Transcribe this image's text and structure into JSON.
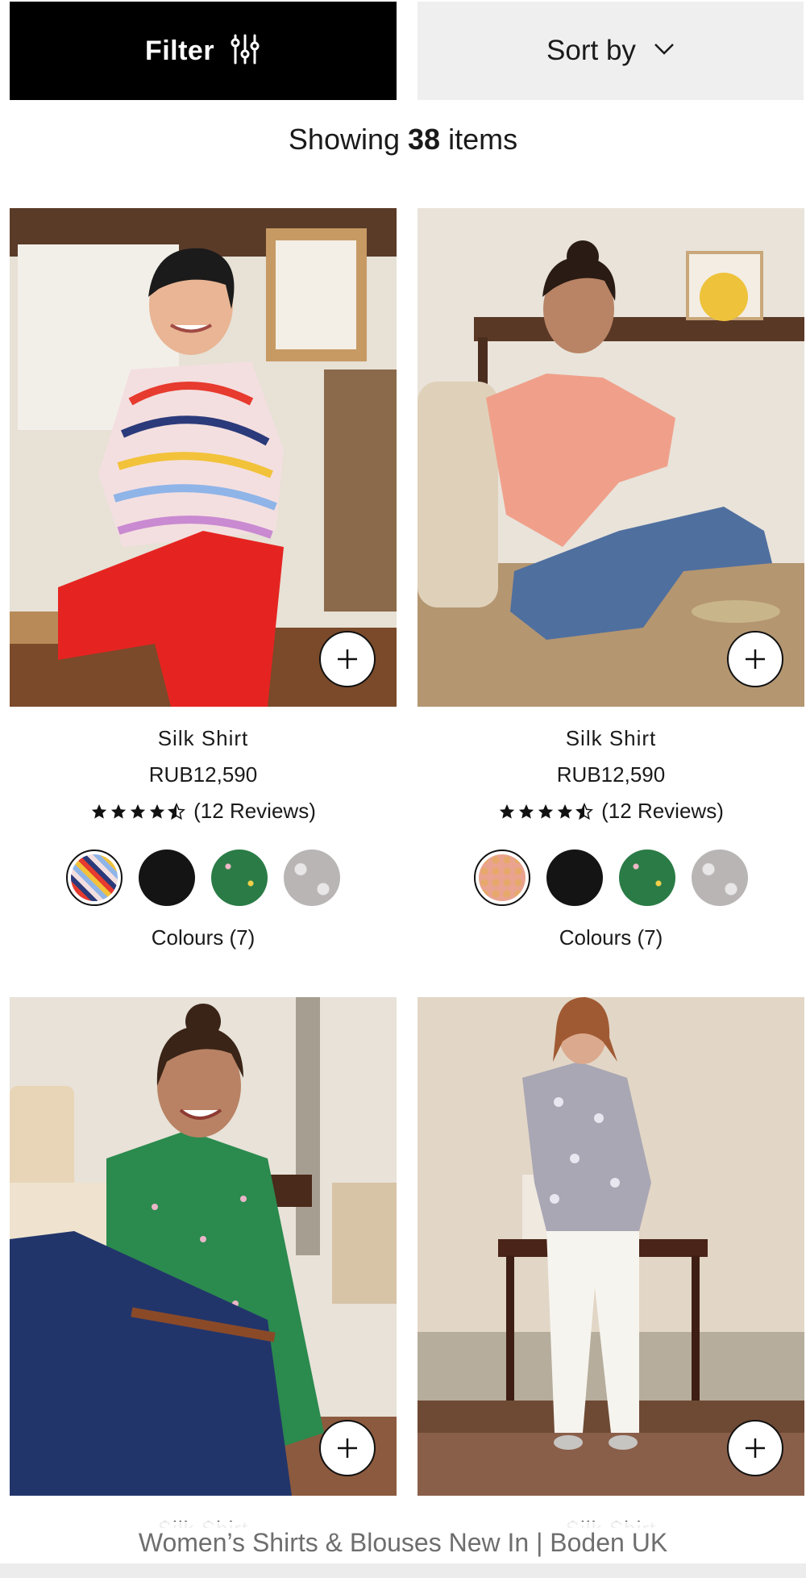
{
  "toolbar": {
    "filter_label": "Filter",
    "filter_icon": "sliders-icon",
    "sort_label": "Sort by",
    "sort_icon": "chevron-down-icon"
  },
  "results": {
    "prefix": "Showing",
    "count": "38",
    "suffix": "items"
  },
  "products": [
    {
      "name": "Silk Shirt",
      "price": "RUB12,590",
      "rating": 4.5,
      "reviews": "(12 Reviews)",
      "swatches": [
        "rainbow-stripe",
        "black",
        "green-floral",
        "grey-spot"
      ],
      "selected_swatch": 0,
      "colours": "Colours (7)"
    },
    {
      "name": "Silk Shirt",
      "price": "RUB12,590",
      "rating": 4.5,
      "reviews": "(12 Reviews)",
      "swatches": [
        "pink-geo",
        "black",
        "green-floral",
        "grey-spot"
      ],
      "selected_swatch": 0,
      "colours": "Colours (7)"
    }
  ],
  "page_title": "Women’s Shirts & Blouses New In | Boden UK",
  "colors": {
    "filter_bg": "#000000",
    "sort_bg": "#efefef",
    "text": "#1a1a1a",
    "title_text": "#6e6e6e"
  }
}
